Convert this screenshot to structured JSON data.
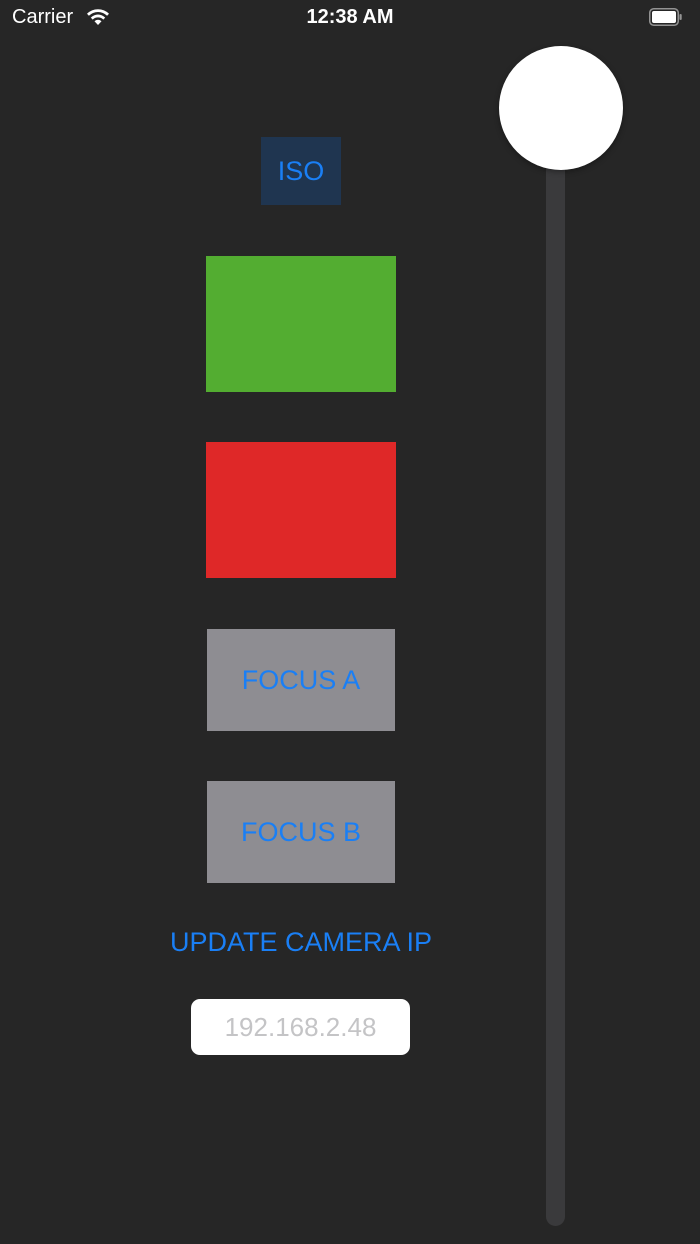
{
  "status_bar": {
    "carrier": "Carrier",
    "time": "12:38 AM",
    "wifi_icon": "wifi-icon",
    "battery_icon": "battery-icon"
  },
  "controls": {
    "iso_label": "ISO",
    "green_color": "#53ad31",
    "red_color": "#df2828",
    "focus_a_label": "FOCUS A",
    "focus_b_label": "FOCUS B",
    "update_ip_label": "UPDATE CAMERA IP",
    "ip_field": {
      "value": "",
      "placeholder": "192.168.2.48"
    }
  },
  "slider": {
    "value": 1.0
  },
  "colors": {
    "background": "#262626",
    "accent": "#1a7ff5",
    "button_gray": "#8e8d92"
  }
}
